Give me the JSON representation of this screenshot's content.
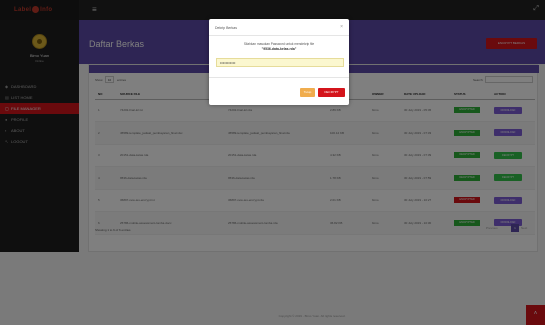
{
  "brand": {
    "left": "Label",
    "right": "Info"
  },
  "user": {
    "name": "Bimo Yuan",
    "role": "Online"
  },
  "nav": [
    {
      "icon": "dashboard-icon",
      "glyph": "◆",
      "label": "DASHBOARD"
    },
    {
      "icon": "list-icon",
      "glyph": "▤",
      "label": "LIST HOME"
    },
    {
      "icon": "file-icon",
      "glyph": "▢",
      "label": "FILE MANAGER"
    },
    {
      "icon": "user-icon",
      "glyph": "●",
      "label": "PROFILE"
    },
    {
      "icon": "info-icon",
      "glyph": "▪",
      "label": "ABOUT"
    },
    {
      "icon": "logout-icon",
      "glyph": "↖",
      "label": "LOGOUT"
    }
  ],
  "header": {
    "title": "Daftar Berkas",
    "upload_label": "ENCRYPT BERKAS"
  },
  "controls": {
    "show": "Show",
    "entries_value": "10",
    "entries": "entries",
    "search": "Search:"
  },
  "table": {
    "headers": [
      "NO",
      "SOURCE FILE",
      "ENCRYPTED FILE",
      "SIZE",
      "OWNER",
      "DATE UPLOAD",
      "STATUS",
      "ACTION"
    ],
    "rows": [
      {
        "no": "1",
        "source": "74202-final-lol.txt",
        "enc": "74202-final-lol.rda",
        "size": "2.89 KB",
        "owner": "bimo",
        "date": "30 July 2019 - 05:45",
        "status": "ENCRYPTED",
        "status_kind": "ok",
        "action": "DOWNLOAD",
        "action_kind": "purple"
      },
      {
        "no": "2",
        "source": "45589-template_jadwal_pembayaran_final.xlsx",
        "enc": "45589-template_jadwal_pembayaran_final.rda",
        "size": "100.12 KB",
        "owner": "bimo",
        "date": "30 July 2019 - 07:33",
        "status": "ENCRYPTED",
        "status_kind": "ok",
        "action": "DOWNLOAD",
        "action_kind": "purple"
      },
      {
        "no": "3",
        "source": "20151-data-kelas.rda",
        "enc": "20151-data-kelas.rda",
        "size": "4.32 KB",
        "owner": "bimo",
        "date": "30 July 2019 - 07:39",
        "status": "DECRYPTED",
        "status_kind": "ok",
        "action": "DECRYPT",
        "action_kind": "green"
      },
      {
        "no": "4",
        "source": "9536-data-kelas.rda",
        "enc": "9536-data-kelas.rda",
        "size": "1.78 KB",
        "owner": "bimo",
        "date": "30 July 2019 - 07:59",
        "status": "DECRYPTED",
        "status_kind": "ok",
        "action": "DECRYPT",
        "action_kind": "green"
      },
      {
        "no": "5",
        "source": "36897-new-tes-encrypt.txt",
        "enc": "36897-new-tes-encrypt.rda",
        "size": "2.01 KB",
        "owner": "bimo",
        "date": "30 July 2019 - 10:27",
        "status": "ENCRYPTED",
        "status_kind": "no",
        "action": "DOWNLOAD",
        "action_kind": "purple"
      },
      {
        "no": "6",
        "source": "25786-mobile-assessment-lomba.docx",
        "enc": "25786-mobile-assessment-lomba.rda",
        "size": "36.82 KB",
        "owner": "bimo",
        "date": "30 July 2019 - 10:30",
        "status": "ENCRYPTED",
        "status_kind": "ok",
        "action": "DOWNLOAD",
        "action_kind": "purple"
      }
    ]
  },
  "footer_info": "Showing 1 to 6 of 6 entries",
  "pager": {
    "prev": "Previous",
    "current": "1",
    "next": "Next"
  },
  "copyright": "Copyright © 2019 - Bimo Yuan. All rights reserved.",
  "modal": {
    "title": "Dekrip Berkas",
    "close": "×",
    "message": "Silahkan masukan Password untuk mendekrip file",
    "file": "\"9536-data-kelas.rda\"",
    "password_value": "•••••••••••",
    "btn_close": "Tutup",
    "btn_decrypt": "DECRYPT"
  }
}
